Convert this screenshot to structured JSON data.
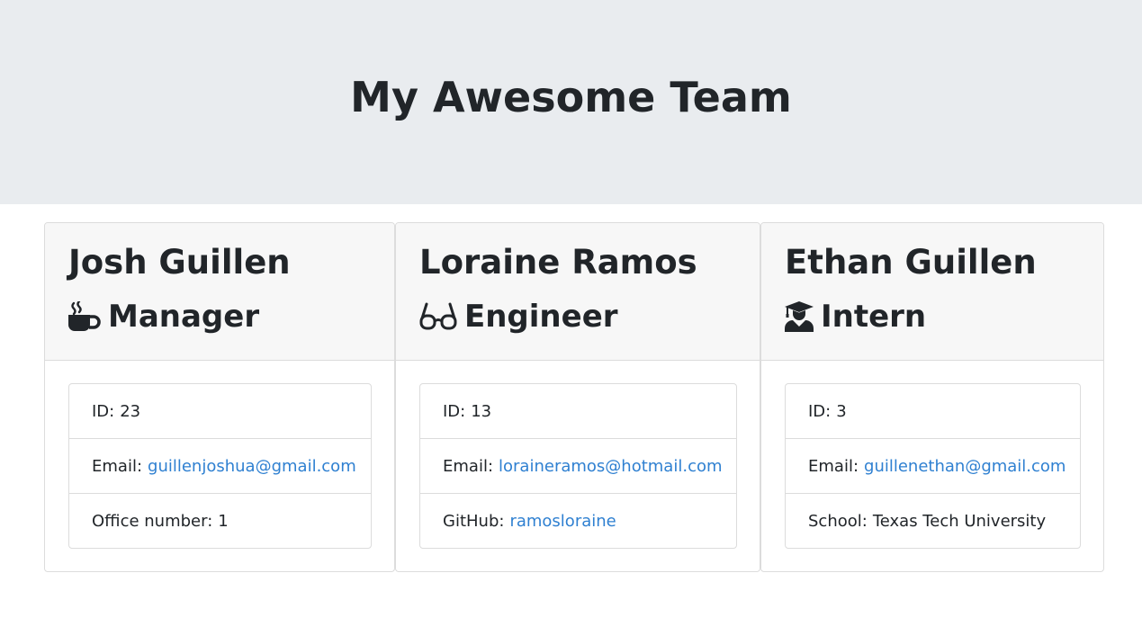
{
  "header": {
    "title": "My Awesome Team"
  },
  "employees": [
    {
      "name": "Josh Guillen",
      "role": "Manager",
      "icon": "coffee-icon",
      "id_label": "ID:",
      "id": "23",
      "email_label": "Email:",
      "email": "guillenjoshua@gmail.com",
      "extra_label": "Office number:",
      "extra_value": "1"
    },
    {
      "name": "Loraine Ramos",
      "role": "Engineer",
      "icon": "glasses-icon",
      "id_label": "ID:",
      "id": "13",
      "email_label": "Email:",
      "email": "loraineramos@hotmail.com",
      "extra_label": "GitHub:",
      "extra_value": "ramosloraine"
    },
    {
      "name": "Ethan Guillen",
      "role": "Intern",
      "icon": "graduate-icon",
      "id_label": "ID:",
      "id": "3",
      "email_label": "Email:",
      "email": "guillenethan@gmail.com",
      "extra_label": "School:",
      "extra_value": "Texas Tech University"
    }
  ],
  "colors": {
    "header_bg": "#e9ecef",
    "link": "#2f80d1",
    "card_header_bg": "#f7f7f7"
  }
}
